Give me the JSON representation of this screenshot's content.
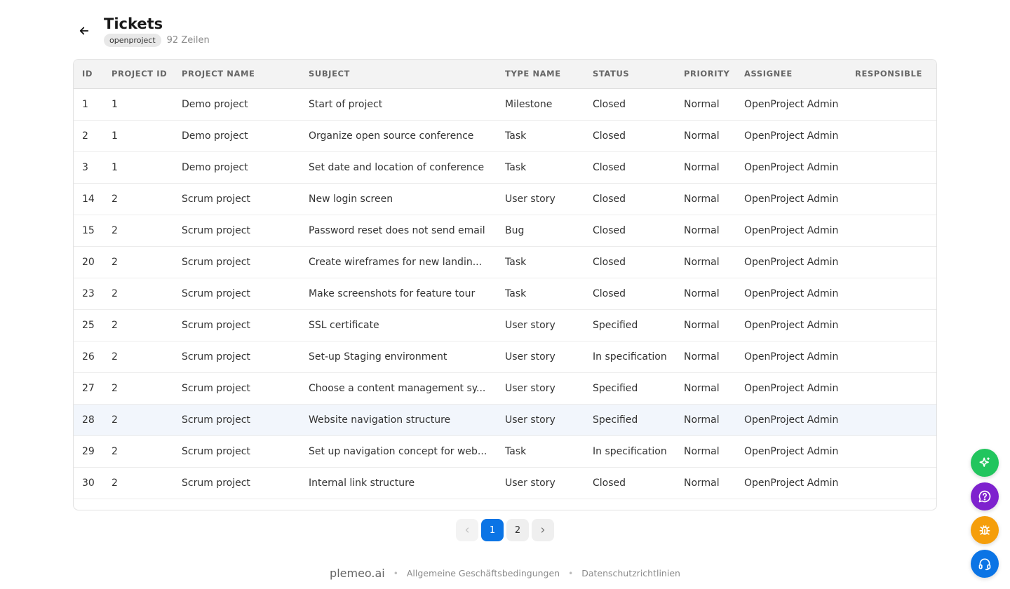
{
  "header": {
    "title": "Tickets",
    "tag": "openproject",
    "row_count": "92 Zeilen"
  },
  "table": {
    "columns": [
      "ID",
      "PROJECT ID",
      "PROJECT NAME",
      "SUBJECT",
      "TYPE NAME",
      "STATUS",
      "PRIORITY",
      "ASSIGNEE",
      "RESPONSIBLE"
    ],
    "rows": [
      [
        "1",
        "1",
        "Demo project",
        "Start of project",
        "Milestone",
        "Closed",
        "Normal",
        "OpenProject Admin",
        ""
      ],
      [
        "2",
        "1",
        "Demo project",
        "Organize open source conference",
        "Task",
        "Closed",
        "Normal",
        "OpenProject Admin",
        ""
      ],
      [
        "3",
        "1",
        "Demo project",
        "Set date and location of conference",
        "Task",
        "Closed",
        "Normal",
        "OpenProject Admin",
        ""
      ],
      [
        "14",
        "2",
        "Scrum project",
        "New login screen",
        "User story",
        "Closed",
        "Normal",
        "OpenProject Admin",
        ""
      ],
      [
        "15",
        "2",
        "Scrum project",
        "Password reset does not send email",
        "Bug",
        "Closed",
        "Normal",
        "OpenProject Admin",
        ""
      ],
      [
        "20",
        "2",
        "Scrum project",
        "Create wireframes for new landin...",
        "Task",
        "Closed",
        "Normal",
        "OpenProject Admin",
        ""
      ],
      [
        "23",
        "2",
        "Scrum project",
        "Make screenshots for feature tour",
        "Task",
        "Closed",
        "Normal",
        "OpenProject Admin",
        ""
      ],
      [
        "25",
        "2",
        "Scrum project",
        "SSL certificate",
        "User story",
        "Specified",
        "Normal",
        "OpenProject Admin",
        ""
      ],
      [
        "26",
        "2",
        "Scrum project",
        "Set-up Staging environment",
        "User story",
        "In specification",
        "Normal",
        "OpenProject Admin",
        ""
      ],
      [
        "27",
        "2",
        "Scrum project",
        "Choose a content management sy...",
        "User story",
        "Specified",
        "Normal",
        "OpenProject Admin",
        ""
      ],
      [
        "28",
        "2",
        "Scrum project",
        "Website navigation structure",
        "User story",
        "Specified",
        "Normal",
        "OpenProject Admin",
        ""
      ],
      [
        "29",
        "2",
        "Scrum project",
        "Set up navigation concept for web...",
        "Task",
        "In specification",
        "Normal",
        "OpenProject Admin",
        ""
      ],
      [
        "30",
        "2",
        "Scrum project",
        "Internal link structure",
        "User story",
        "Closed",
        "Normal",
        "OpenProject Admin",
        ""
      ]
    ],
    "highlighted_row": 10
  },
  "pagination": {
    "prev_icon": "chevron-left-icon",
    "pages": [
      "1",
      "2"
    ],
    "current": "1",
    "next_icon": "chevron-right-icon"
  },
  "footer": {
    "brand": "plemeo.ai",
    "links": [
      "Allgemeine Geschäftsbedingungen",
      "Datenschutzrichtlinien"
    ]
  },
  "fabs": [
    {
      "icon": "sparkle-icon",
      "color": "#22c55e"
    },
    {
      "icon": "help-chat-icon",
      "color": "#7e22ce"
    },
    {
      "icon": "bug-icon",
      "color": "#f59e0b"
    },
    {
      "icon": "headset-icon",
      "color": "#0b74e5"
    }
  ]
}
